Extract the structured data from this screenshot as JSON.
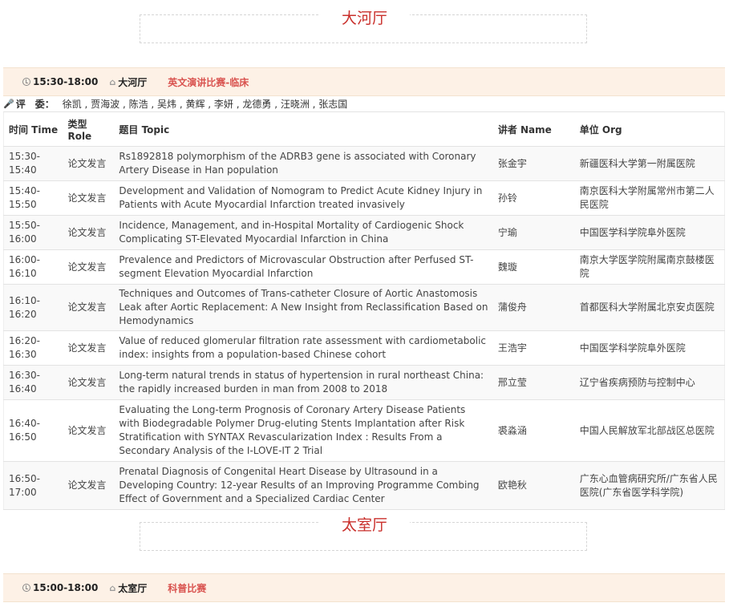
{
  "halls": [
    {
      "title": "大河厅"
    },
    {
      "title": "太室厅"
    }
  ],
  "sessions": [
    {
      "time": "15:30-18:00",
      "room": "大河厅",
      "name": "英文演讲比赛-临床"
    },
    {
      "time": "15:00-18:00",
      "room": "太室厅",
      "name": "科普比赛"
    }
  ],
  "judges": {
    "label": "评　委：",
    "names": "徐凯 , 贾海波 , 陈浩 , 吴炜 , 黄辉 , 李妍 , 龙德勇 , 汪晓洲 , 张志国"
  },
  "table": {
    "headers": {
      "time": "时间 Time",
      "role": "类型 Role",
      "topic": "题目 Topic",
      "speaker": "讲者 Name",
      "org": "单位 Org"
    },
    "rows": [
      {
        "time": "15:30-15:40",
        "role": "论文发言",
        "topic": "Rs1892818 polymorphism of the ADRB3 gene is associated with Coronary Artery Disease in Han population",
        "speaker": "张金宇",
        "org": "新疆医科大学第一附属医院"
      },
      {
        "time": "15:40-15:50",
        "role": "论文发言",
        "topic": "Development and Validation of Nomogram to Predict Acute Kidney Injury in Patients with Acute Myocardial Infarction treated invasively",
        "speaker": "孙铃",
        "org": "南京医科大学附属常州市第二人民医院"
      },
      {
        "time": "15:50-16:00",
        "role": "论文发言",
        "topic": "Incidence, Management, and in-Hospital Mortality of Cardiogenic Shock Complicating ST-Elevated Myocardial Infarction in China",
        "speaker": "宁瑜",
        "org": "中国医学科学院阜外医院"
      },
      {
        "time": "16:00-16:10",
        "role": "论文发言",
        "topic": "Prevalence and Predictors of Microvascular Obstruction after Perfused ST-segment Elevation Myocardial Infarction",
        "speaker": "魏璇",
        "org": "南京大学医学院附属南京鼓楼医院"
      },
      {
        "time": "16:10-16:20",
        "role": "论文发言",
        "topic": "Techniques and Outcomes of Trans-catheter Closure of Aortic Anastomosis Leak after Aortic Replacement: A New Insight from Reclassification Based on Hemodynamics",
        "speaker": "蒲俊舟",
        "org": "首都医科大学附属北京安贞医院"
      },
      {
        "time": "16:20-16:30",
        "role": "论文发言",
        "topic": "Value of reduced glomerular filtration rate assessment with cardiometabolic index: insights from a population-based Chinese cohort",
        "speaker": "王浩宇",
        "org": "中国医学科学院阜外医院"
      },
      {
        "time": "16:30-16:40",
        "role": "论文发言",
        "topic": "Long-term natural trends in status of hypertension in rural northeast China: the rapidly increased burden in man from 2008 to 2018",
        "speaker": "邢立莹",
        "org": "辽宁省疾病预防与控制中心"
      },
      {
        "time": "16:40-16:50",
        "role": "论文发言",
        "topic": "Evaluating the Long-term Prognosis of Coronary Artery Disease Patients with Biodegradable Polymer Drug-eluting Stents Implantation after Risk Stratification with SYNTAX Revascularization Index : Results From a Secondary Analysis of the I-LOVE-IT 2 Trial",
        "speaker": "裘淼涵",
        "org": "中国人民解放军北部战区总医院"
      },
      {
        "time": "16:50-17:00",
        "role": "论文发言",
        "topic": "Prenatal Diagnosis of Congenital Heart Disease by Ultrasound in a Developing Country: 12-year Results of an Improving Programme Combing Effect of Government and a Specialized Cardiac Center",
        "speaker": "欧艳秋",
        "org": "广东心血管病研究所/广东省人民医院(广东省医学科学院)"
      }
    ]
  }
}
